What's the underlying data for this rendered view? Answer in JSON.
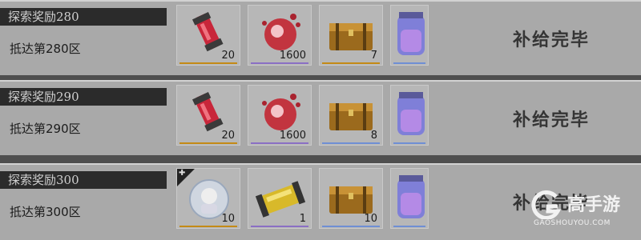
{
  "rows": [
    {
      "title": "探索奖励280",
      "subtitle": "抵达第280区",
      "status": "补给完毕",
      "items": [
        {
          "icon": "red-canister-icon",
          "qty": "20"
        },
        {
          "icon": "red-crystal-icon",
          "qty": "1600"
        },
        {
          "icon": "treasure-chest-icon",
          "qty": "7"
        },
        {
          "icon": "potion-jar-icon",
          "qty": ""
        }
      ]
    },
    {
      "title": "探索奖励290",
      "subtitle": "抵达第290区",
      "status": "补给完毕",
      "items": [
        {
          "icon": "red-canister-icon",
          "qty": "20"
        },
        {
          "icon": "red-crystal-icon",
          "qty": "1600"
        },
        {
          "icon": "treasure-chest-icon",
          "qty": "8"
        },
        {
          "icon": "potion-jar-icon",
          "qty": ""
        }
      ]
    },
    {
      "title": "探索奖励300",
      "subtitle": "抵达第300区",
      "status": "补给完毕",
      "items": [
        {
          "icon": "character-portrait-icon",
          "qty": "10"
        },
        {
          "icon": "golden-capsule-icon",
          "qty": "1"
        },
        {
          "icon": "treasure-chest-icon",
          "qty": "10"
        },
        {
          "icon": "potion-jar-icon",
          "qty": ""
        }
      ]
    }
  ],
  "watermark": {
    "brand": "高手游",
    "url": "GAOSHOUYOU.COM"
  },
  "colors": {
    "gold_bar": "#c48a16",
    "purple_bar": "#8a6fc4",
    "blue_bar": "#6f8fd4"
  }
}
